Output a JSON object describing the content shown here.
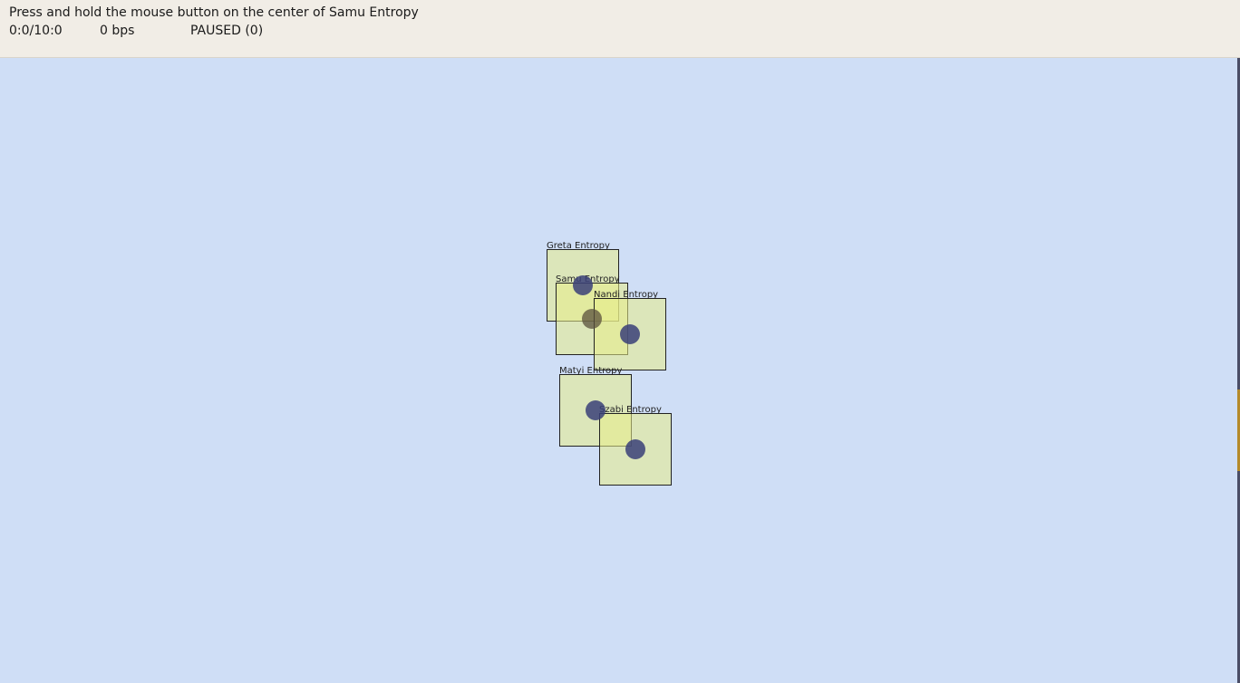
{
  "header": {
    "instruction": "Press and hold the mouse button on the center of Samu Entropy",
    "time": "0:0/10:0",
    "bps": "0 bps",
    "state": "PAUSED (0)"
  },
  "agents": [
    {
      "id": "greta",
      "label": "Greta  Entropy"
    },
    {
      "id": "samu",
      "label": "Samu  Entropy"
    },
    {
      "id": "nandi",
      "label": "Nandi  Entropy"
    },
    {
      "id": "matyi",
      "label": "Matyi  Entropy"
    },
    {
      "id": "szabi",
      "label": "Szabi  Entropy"
    }
  ],
  "colors": {
    "canvas": "#cfdef6",
    "header": "#f1ede6",
    "box_fill": "#e8ec88",
    "dot": "#3a4078"
  }
}
